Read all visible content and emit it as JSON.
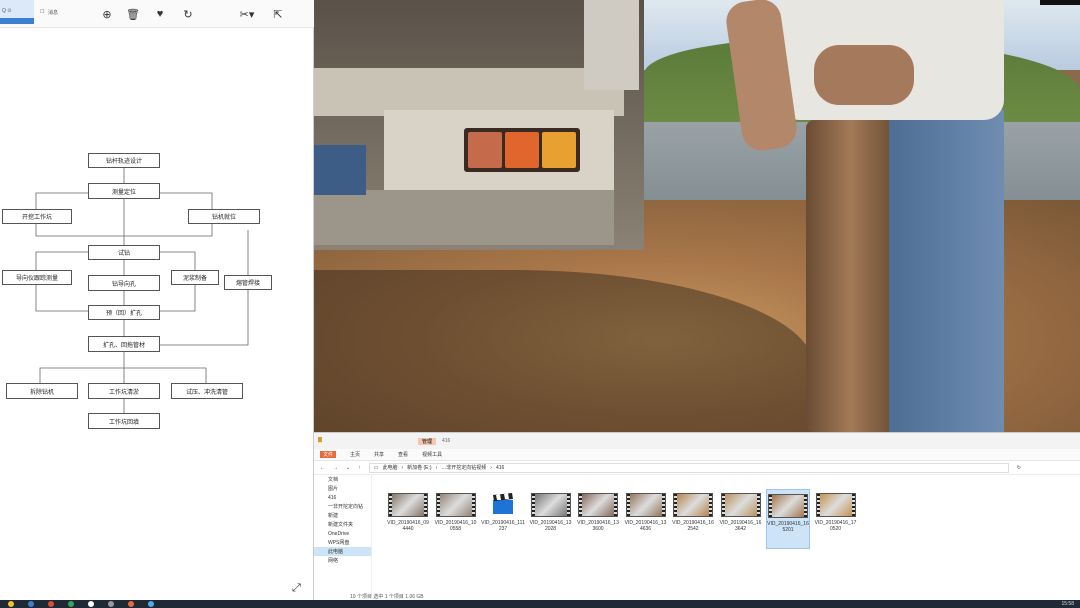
{
  "viewer": {
    "toolbar": {
      "label_left": "Q ⊙",
      "label_tool": "消息",
      "zoom_icon": "zoom-in-icon",
      "delete_icon": "trash-icon",
      "favorite_icon": "heart-icon",
      "rotate_icon": "rotate-icon",
      "tools_icon": "tools-icon",
      "share_icon": "share-icon"
    },
    "flowchart": {
      "nodes": [
        {
          "id": "n1",
          "label": "钻杆轨迹设计"
        },
        {
          "id": "n2",
          "label": "测量定位"
        },
        {
          "id": "n3",
          "label": "开挖工作坑"
        },
        {
          "id": "n4",
          "label": "钻机就位"
        },
        {
          "id": "n5",
          "label": "试钻"
        },
        {
          "id": "n6",
          "label": "导向仪跟踪测量"
        },
        {
          "id": "n7",
          "label": "钻导向孔"
        },
        {
          "id": "n8",
          "label": "泥浆制备"
        },
        {
          "id": "n9",
          "label": "熔管焊接"
        },
        {
          "id": "n10",
          "label": "预（回）扩孔"
        },
        {
          "id": "n11",
          "label": "扩孔、回拖管材"
        },
        {
          "id": "n12",
          "label": "拆除钻机"
        },
        {
          "id": "n13",
          "label": "工作坑清淤"
        },
        {
          "id": "n14",
          "label": "试压、冲洗清管"
        },
        {
          "id": "n15",
          "label": "工作坑回填"
        }
      ]
    }
  },
  "explorer": {
    "title_tab": "管理",
    "title_path": "416",
    "ribbon": [
      "文件",
      "主页",
      "共享",
      "查看",
      "视频工具"
    ],
    "ribbon_highlight": "管理",
    "address": [
      "此电脑",
      "新加卷 (E:)",
      "…非开挖定向钻视频",
      "416"
    ],
    "nav": [
      {
        "label": "文档",
        "selected": false
      },
      {
        "label": "图片",
        "selected": false
      },
      {
        "label": "416",
        "selected": false
      },
      {
        "label": "一非开挖定向钻",
        "selected": false
      },
      {
        "label": "新建",
        "selected": false
      },
      {
        "label": "新建文件夹",
        "selected": false
      },
      {
        "label": "OneDrive",
        "selected": false
      },
      {
        "label": "WPS网盘",
        "selected": false
      },
      {
        "label": "此电脑",
        "selected": true
      },
      {
        "label": "网络",
        "selected": false
      }
    ],
    "files": [
      {
        "name": "VID_20190416_094440",
        "kind": "thumb",
        "tint": "#7a6a5a",
        "selected": false
      },
      {
        "name": "VID_20190416_100558",
        "kind": "thumb",
        "tint": "#8a7a6a",
        "selected": false
      },
      {
        "name": "VID_20190416_111237",
        "kind": "clapper",
        "tint": "#1e73d6",
        "selected": false
      },
      {
        "name": "VID_20190416_132028",
        "kind": "thumb",
        "tint": "#6a6a6a",
        "selected": false
      },
      {
        "name": "VID_20190416_133600",
        "kind": "thumb",
        "tint": "#7a5a4a",
        "selected": false
      },
      {
        "name": "VID_20190416_134636",
        "kind": "thumb",
        "tint": "#8a6a4a",
        "selected": false
      },
      {
        "name": "VID_20190416_162542",
        "kind": "thumb",
        "tint": "#b07a40",
        "selected": false
      },
      {
        "name": "VID_20190416_163642",
        "kind": "thumb",
        "tint": "#b38a50",
        "selected": false
      },
      {
        "name": "VID_20190416_165201",
        "kind": "thumb",
        "tint": "#9a6a3a",
        "selected": true
      },
      {
        "name": "VID_20190416_170520",
        "kind": "thumb",
        "tint": "#c08a40",
        "selected": false
      }
    ],
    "status": "10 个项目    选中 1 个项目  1.06 GB"
  },
  "taskbar": {
    "clock": "15:58",
    "colors": [
      "#f2c12e",
      "#3b7fd1",
      "#e04b3a",
      "#3aa35a",
      "#ffffff",
      "#9a9a9a",
      "#e86a3a",
      "#55aaee"
    ]
  }
}
